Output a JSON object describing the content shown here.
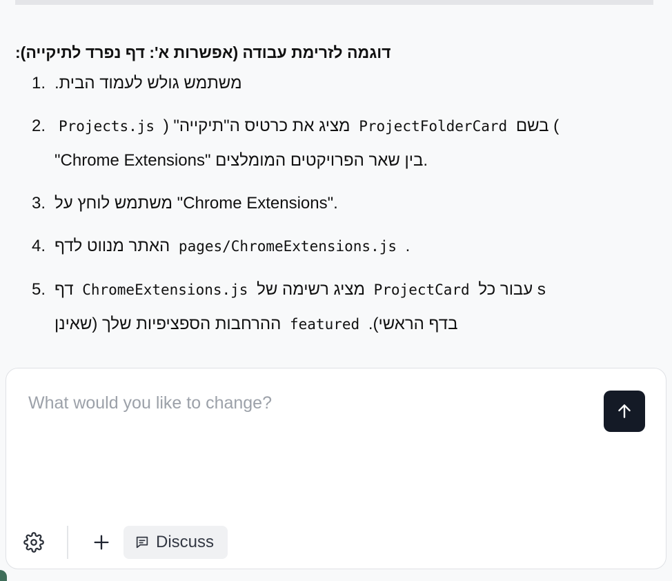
{
  "message": {
    "heading": "דוגמה לזרימת עבודה (אפשרות א': דף נפרד לתיקייה):",
    "steps": [
      {
        "number": "1.",
        "text": "משתמש גולש לעמוד הבית."
      },
      {
        "number": "2.",
        "code_1": "Projects.js",
        "text_1": "מציג את כרטיס ה\"תיקייה\" (",
        "code_2": "ProjectFolderCard",
        "text_2": ") בשם",
        "line_2": "\"Chrome Extensions\" בין שאר הפרויקטים המומלצים."
      },
      {
        "number": "3.",
        "text": "משתמש לוחץ על \"Chrome Extensions\"."
      },
      {
        "number": "4.",
        "text": "האתר מנווט לדף",
        "code": "pages/ChromeExtensions.js",
        "suffix": "."
      },
      {
        "number": "5.",
        "code_1": "ChromeExtensions.js",
        "text_1": "דף",
        "text_2": "מציג רשימה של",
        "code_2": "ProjectCard",
        "text_3": "s עבור כל",
        "line_2_text_1": "ההרחבות הספציפיות שלך (שאינן",
        "line_2_code": "featured",
        "line_2_text_2": "בדף הראשי)."
      }
    ]
  },
  "composer": {
    "placeholder": "What would you like to change?",
    "value": "",
    "discuss_label": "Discuss"
  },
  "icons": {
    "send": "arrow-up-icon",
    "settings": "gear-icon",
    "add": "plus-icon",
    "discuss": "chat-bubble-icon"
  },
  "colors": {
    "send_button_bg": "#141a26",
    "discuss_bg": "#f0f1f3",
    "placeholder": "#9ca1a9"
  }
}
